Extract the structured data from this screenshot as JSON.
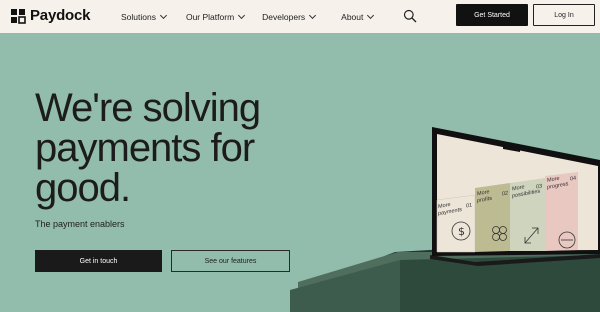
{
  "brand": {
    "name": "Paydock"
  },
  "nav": {
    "items": [
      {
        "label": "Solutions"
      },
      {
        "label": "Our Platform"
      },
      {
        "label": "Developers"
      },
      {
        "label": "About"
      }
    ],
    "get_started_label": "Get Started",
    "login_label": "Log In"
  },
  "hero": {
    "title": "We're solving\npayments for\ngood.",
    "subtitle": "The payment enablers",
    "primary_cta": "Get in touch",
    "secondary_cta": "See our features"
  },
  "laptop_cards": [
    {
      "label": "More\npayments",
      "number": "01"
    },
    {
      "label": "More\nprofits",
      "number": "02"
    },
    {
      "label": "More\npossibilities",
      "number": "03"
    },
    {
      "label": "More\nprogress",
      "number": "04"
    }
  ],
  "colors": {
    "background": "#92bcab",
    "header": "#f6f1eb",
    "dark": "#111111",
    "pedestal": "#3e5c4d"
  },
  "icons": [
    "search-icon",
    "chevron-down-icon",
    "dollar-icon",
    "growth-icon",
    "expand-icon",
    "arrow-icon"
  ]
}
